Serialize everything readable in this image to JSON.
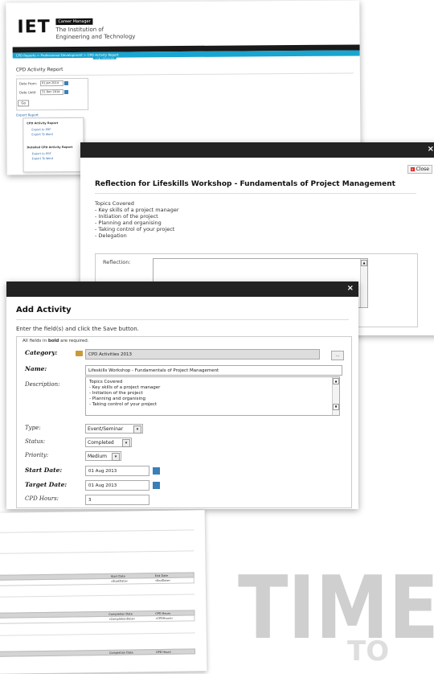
{
  "iet_page": {
    "logo": "IET",
    "brand_tag": "Career Manager",
    "institution_line1": "The Institution of",
    "institution_line2": "Engineering and Technology",
    "nav_items": [
      "Home",
      "My Account",
      "My Development",
      "My Records"
    ],
    "breadcrumb": "CPD Reports > Professional Development > CPD Activity Report",
    "report_title": "CPD Activity Report",
    "filter": {
      "date_from_label": "Date From:",
      "date_from_value": "01 Jan 2014",
      "date_until_label": "Date Until:",
      "date_until_value": "31 Dec 2014",
      "go_label": "Go"
    },
    "export_label": "Export Report",
    "export_menu": {
      "section1_title": "CPD Activity Report",
      "section1_pdf": "Export to PDF",
      "section1_word": "Export To Word",
      "section2_title": "Detailed CPD Activity Report",
      "section2_pdf": "Export to PDF",
      "section2_word": "Export To Word"
    }
  },
  "reflection_modal": {
    "close_x": "×",
    "close_button": "Close",
    "title": "Reflection for Lifeskills Workshop - Fundamentals of Project Management",
    "topics": [
      "Topics Covered",
      "- Key skills of a project manager",
      "- Initiation of the project",
      "- Planning and organising",
      "- Taking control of your project",
      "- Delegation"
    ],
    "reflection_label": "Reflection:"
  },
  "add_activity_modal": {
    "close_x": "×",
    "title": "Add Activity",
    "instructions": "Enter the field(s) and click the Save button.",
    "required_note_pre": "All fields in ",
    "required_note_bold": "bold",
    "required_note_post": " are required.",
    "category_label": "Category:",
    "category_value": "CPD Activities 2013",
    "category_browse": "...",
    "name_label": "Name:",
    "name_value": "Lifeskills Workshop - Fundamentals of Project Management",
    "description_label": "Description:",
    "description_lines": [
      "Topics Covered",
      "- Key skills of a project manager",
      "- Initiation of the project",
      "- Planning and organising",
      "- Taking control of your project"
    ],
    "type_label": "Type:",
    "type_value": "Event/Seminar",
    "status_label": "Status:",
    "status_value": "Completed",
    "priority_label": "Priority:",
    "priority_value": "Medium",
    "start_date_label": "Start Date:",
    "start_date_value": "01 Aug 2013",
    "target_date_label": "Target Date:",
    "target_date_value": "01 Aug 2013",
    "cpd_hours_label": "CPD Hours:",
    "cpd_hours_value": "3"
  },
  "report_table": {
    "section1_headers": [
      "Start Date",
      "End Date"
    ],
    "section1_row": [
      "«StartDate»",
      "«EndDate»"
    ],
    "section1_lead": "»",
    "section2_headers": [
      "Completion Date",
      "CPD Hours"
    ],
    "section2_row": [
      "«CompletionDate»",
      "«CPDHours»"
    ],
    "section3_headers": [
      "Completion Date",
      "CPD Hours"
    ]
  },
  "decor": {
    "word": "TIME",
    "subword": "TO"
  }
}
